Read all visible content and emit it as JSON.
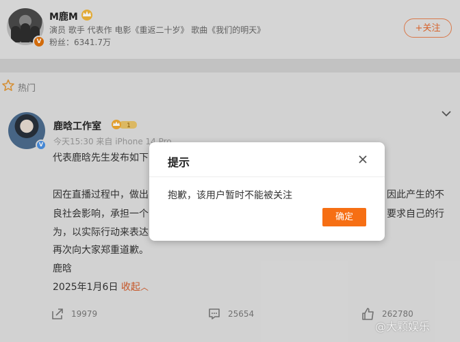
{
  "profile": {
    "name": "M鹿M",
    "description": "演员 歌手 代表作 电影《重返二十岁》 歌曲《我们的明天》",
    "fans": "粉丝：6341.7万",
    "follow_label": "+关注"
  },
  "hot": {
    "label": "热门"
  },
  "post": {
    "author": "鹿晗工作室",
    "vip_level": "1",
    "meta": "今天15:30 来自 iPhone 14 Pro",
    "lines": [
      "代表鹿晗先生发布如下",
      "因在直播过程中，做出",
      "良社会影响，承担一个",
      "为，以实际行动来表达",
      "再次向大家郑重道歉。",
      "鹿晗"
    ],
    "right_fragments": {
      "line1": "因此产生的不",
      "line2": "要求自己的行"
    },
    "date": "2025年1月6日",
    "collapse_label": "收起",
    "actions": {
      "share_count": "19979",
      "comment_count": "25654",
      "like_count": "262780"
    }
  },
  "watermark": "@大颗娱乐",
  "modal": {
    "title": "提示",
    "message": "抱歉，该用户暂时不能被关注",
    "ok_label": "确定"
  },
  "colors": {
    "accent": "#f66f14",
    "follow_border": "#e77f4e",
    "link": "#d25a28"
  }
}
